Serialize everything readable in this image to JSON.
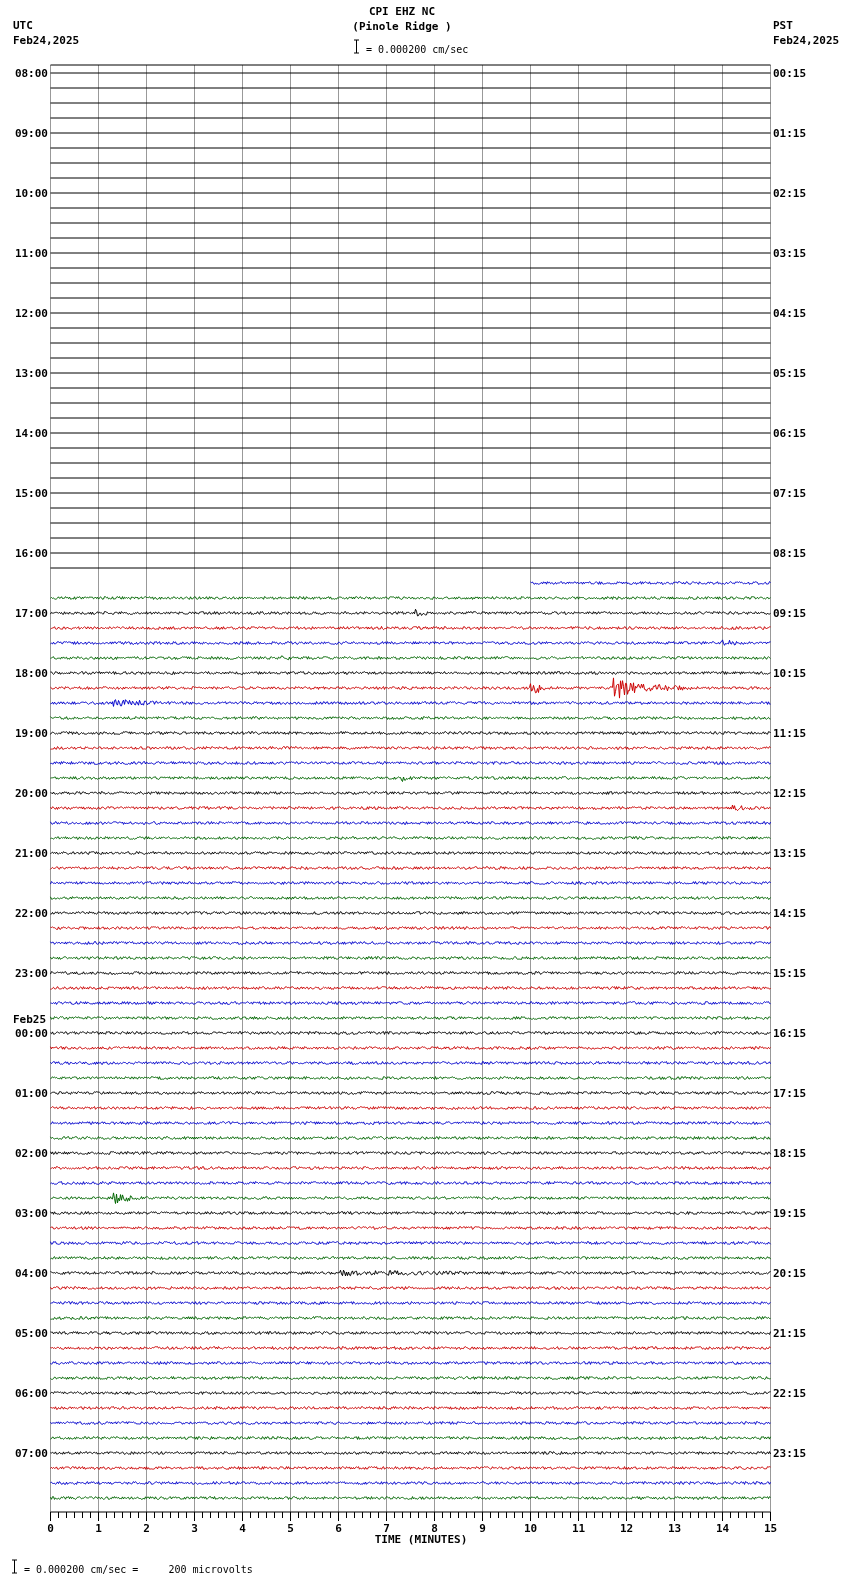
{
  "header": {
    "left": {
      "timezone": "UTC",
      "date": "Feb24,2025"
    },
    "title": "CPI EHZ NC",
    "subtitle": "(Pinole Ridge )",
    "scale_label": "= 0.000200 cm/sec",
    "right": {
      "timezone": "PST",
      "date": "Feb24,2025"
    }
  },
  "rows": [
    {
      "utc": "08:00",
      "pst": "00:15"
    },
    {
      "utc": "09:00",
      "pst": "01:15"
    },
    {
      "utc": "10:00",
      "pst": "02:15"
    },
    {
      "utc": "11:00",
      "pst": "03:15"
    },
    {
      "utc": "12:00",
      "pst": "04:15"
    },
    {
      "utc": "13:00",
      "pst": "05:15"
    },
    {
      "utc": "14:00",
      "pst": "06:15"
    },
    {
      "utc": "15:00",
      "pst": "07:15"
    },
    {
      "utc": "16:00",
      "pst": "08:15"
    },
    {
      "utc": "17:00",
      "pst": "09:15"
    },
    {
      "utc": "18:00",
      "pst": "10:15"
    },
    {
      "utc": "19:00",
      "pst": "11:15"
    },
    {
      "utc": "20:00",
      "pst": "12:15"
    },
    {
      "utc": "21:00",
      "pst": "13:15"
    },
    {
      "utc": "22:00",
      "pst": "14:15"
    },
    {
      "utc": "23:00",
      "pst": "15:15"
    },
    {
      "utc": "00:00",
      "pst": "16:15",
      "date": "Feb25"
    },
    {
      "utc": "01:00",
      "pst": "17:15"
    },
    {
      "utc": "02:00",
      "pst": "18:15"
    },
    {
      "utc": "03:00",
      "pst": "19:15"
    },
    {
      "utc": "04:00",
      "pst": "20:15"
    },
    {
      "utc": "05:00",
      "pst": "21:15"
    },
    {
      "utc": "06:00",
      "pst": "22:15"
    },
    {
      "utc": "07:00",
      "pst": "23:15"
    }
  ],
  "x_axis": {
    "ticks": [
      "0",
      "1",
      "2",
      "3",
      "4",
      "5",
      "6",
      "7",
      "8",
      "9",
      "10",
      "11",
      "12",
      "13",
      "14",
      "15"
    ],
    "label": "TIME (MINUTES)"
  },
  "footer": {
    "scale_label": "= 0.000200 cm/sec =     200 microvolts"
  }
}
